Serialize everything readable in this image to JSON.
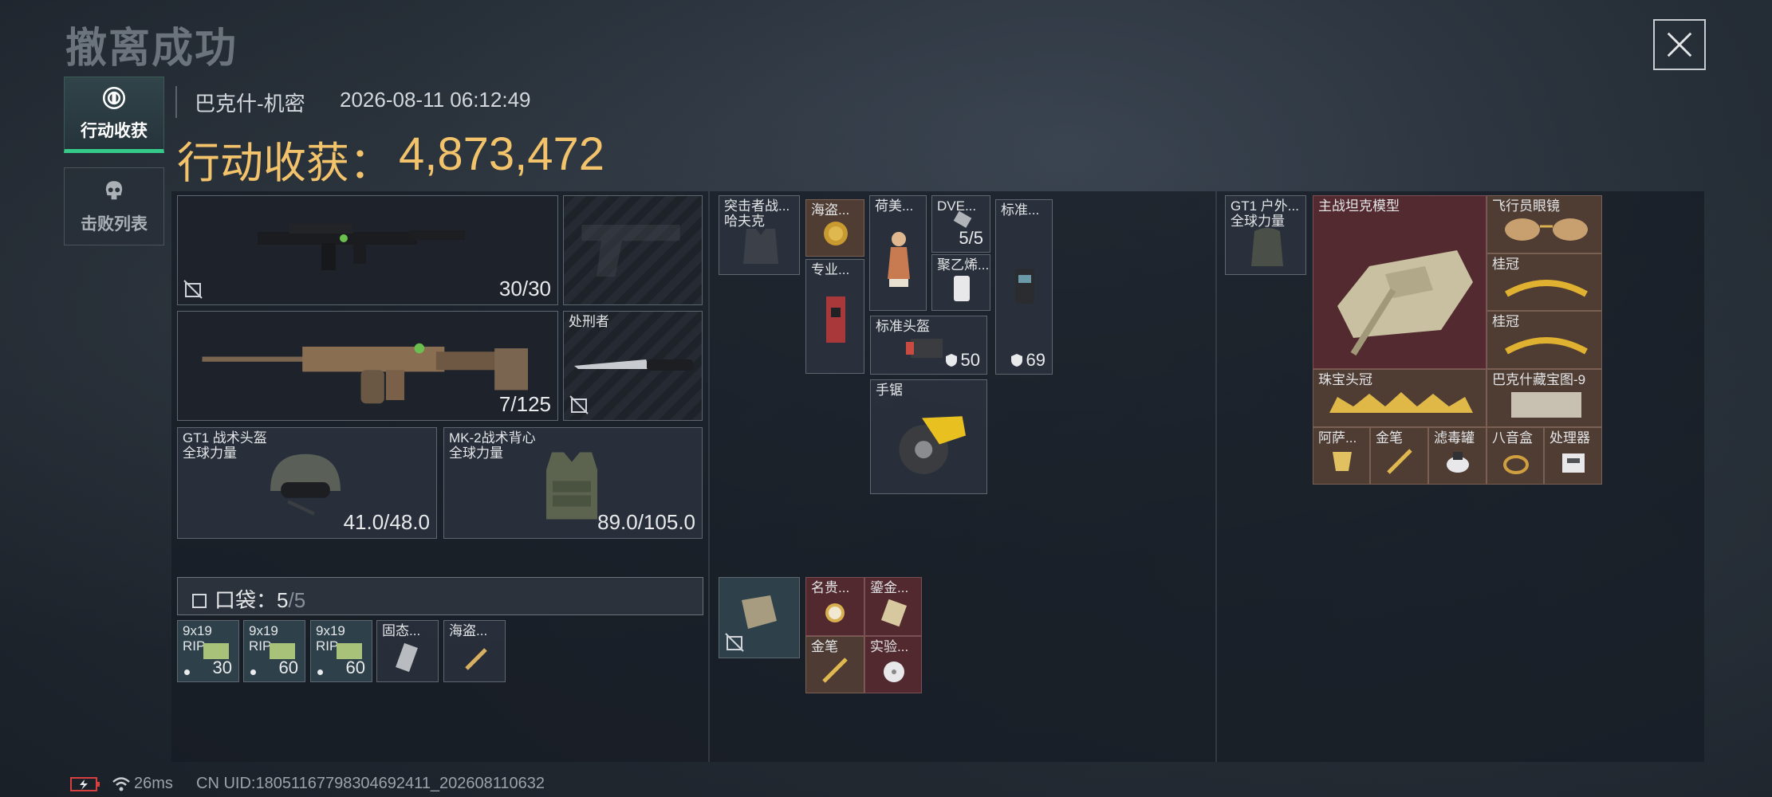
{
  "page": {
    "title": "撤离成功",
    "close_icon": "close-icon"
  },
  "tabs": {
    "loot_label": "行动收获",
    "kills_label": "击败列表"
  },
  "header": {
    "map": "巴克什-机密",
    "datetime": "2026-08-11 06:12:49",
    "haul_label": "行动收获：",
    "haul_value": "4,873,472"
  },
  "loadout": {
    "primary_ammo": "30/30",
    "secondary_ammo": "7/125",
    "melee_label": "处刑者",
    "helmet_name": "GT1 战术头盔",
    "helmet_brand": "全球力量",
    "helmet_durability": "41.0/48.0",
    "vest_name": "MK-2战术背心",
    "vest_brand": "全球力量",
    "vest_durability": "89.0/105.0"
  },
  "pocket": {
    "label": "口袋：",
    "count": "5",
    "capacity": "/5",
    "items": [
      {
        "name": "9x19",
        "sub": "RIP",
        "count": "30"
      },
      {
        "name": "9x19",
        "sub": "RIP",
        "count": "60"
      },
      {
        "name": "9x19",
        "sub": "RIP",
        "count": "60"
      },
      {
        "name": "固态...",
        "sub": "",
        "count": ""
      },
      {
        "name": "海盗...",
        "sub": "",
        "count": ""
      }
    ]
  },
  "rig": {
    "name": "突击者战...",
    "sub": "哈夫克",
    "items": {
      "pirate": "海盗...",
      "pro": "专业...",
      "dutch": "荷美...",
      "dve": "DVE...",
      "dve_count": "5/5",
      "poly": "聚乙烯...",
      "std_top": "标准...",
      "std_head": "标准头盔",
      "std_head_val": "50",
      "std_val": "69",
      "saw": "手锯"
    }
  },
  "case": {
    "items": {
      "watch": "名贵...",
      "gilt": "鎏金...",
      "pen": "金笔",
      "lab": "实验..."
    }
  },
  "backpack": {
    "name": "GT1 户外...",
    "sub": "全球力量",
    "items": {
      "tank": "主战坦克模型",
      "aviator": "飞行员眼镜",
      "laurel1": "桂冠",
      "laurel2": "桂冠",
      "crown": "珠宝头冠",
      "map": "巴克什藏宝图-9",
      "cup": "阿萨...",
      "pen": "金笔",
      "filter": "滤毒罐",
      "box": "八音盒",
      "cpu": "处理器"
    }
  },
  "footer": {
    "ping": "26ms",
    "uid": "CN UID:18051167798304692411_202608110632"
  }
}
